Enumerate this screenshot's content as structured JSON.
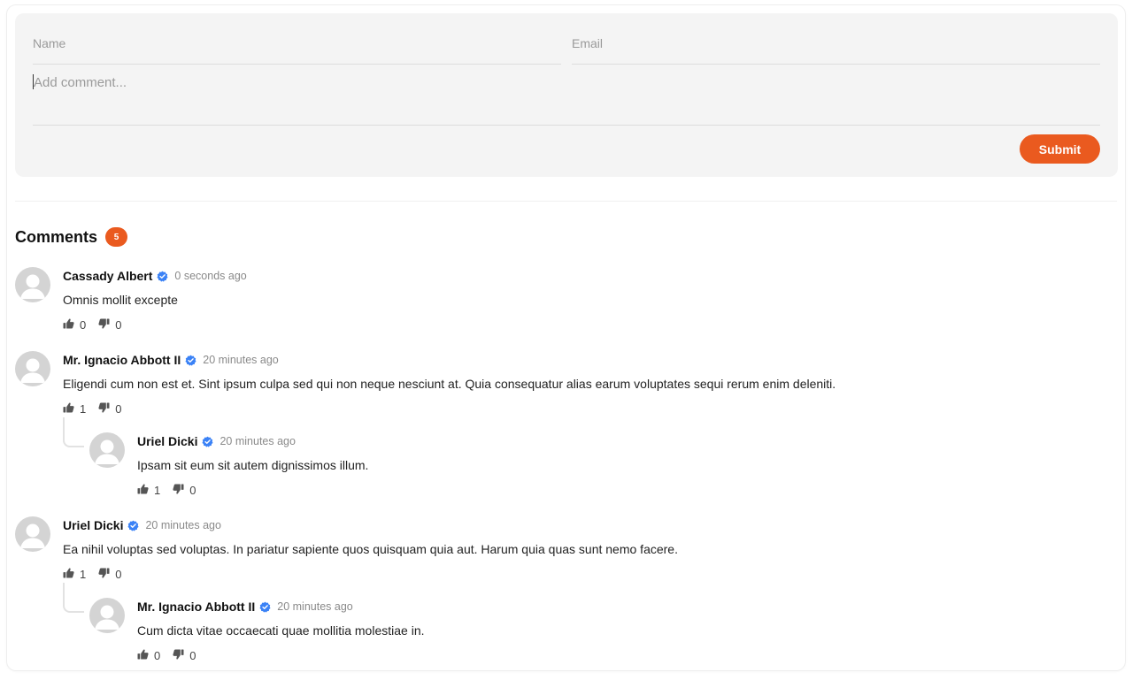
{
  "form": {
    "name_placeholder": "Name",
    "email_placeholder": "Email",
    "comment_placeholder": "Add comment...",
    "submit_label": "Submit"
  },
  "comments_section": {
    "title": "Comments",
    "count": "5"
  },
  "comments": [
    {
      "author": "Cassady Albert",
      "time": "0 seconds ago",
      "text": "Omnis mollit excepte",
      "likes": "0",
      "dislikes": "0"
    },
    {
      "author": "Mr. Ignacio Abbott II",
      "time": "20 minutes ago",
      "text": "Eligendi cum non est et. Sint ipsum culpa sed qui non neque nesciunt at. Quia consequatur alias earum voluptates sequi rerum enim deleniti.",
      "likes": "1",
      "dislikes": "0",
      "replies": [
        {
          "author": "Uriel Dicki",
          "time": "20 minutes ago",
          "text": "Ipsam sit eum sit autem dignissimos illum.",
          "likes": "1",
          "dislikes": "0"
        }
      ]
    },
    {
      "author": "Uriel Dicki",
      "time": "20 minutes ago",
      "text": "Ea nihil voluptas sed voluptas. In pariatur sapiente quos quisquam quia aut. Harum quia quas sunt nemo facere.",
      "likes": "1",
      "dislikes": "0",
      "replies": [
        {
          "author": "Mr. Ignacio Abbott II",
          "time": "20 minutes ago",
          "text": "Cum dicta vitae occaecati quae mollitia molestiae in.",
          "likes": "0",
          "dislikes": "0"
        }
      ]
    }
  ],
  "colors": {
    "accent": "#ea5a1f",
    "verified": "#3b82f6"
  },
  "icons": [
    "user-avatar-icon",
    "verified-badge-icon",
    "thumbs-up-icon",
    "thumbs-down-icon"
  ]
}
